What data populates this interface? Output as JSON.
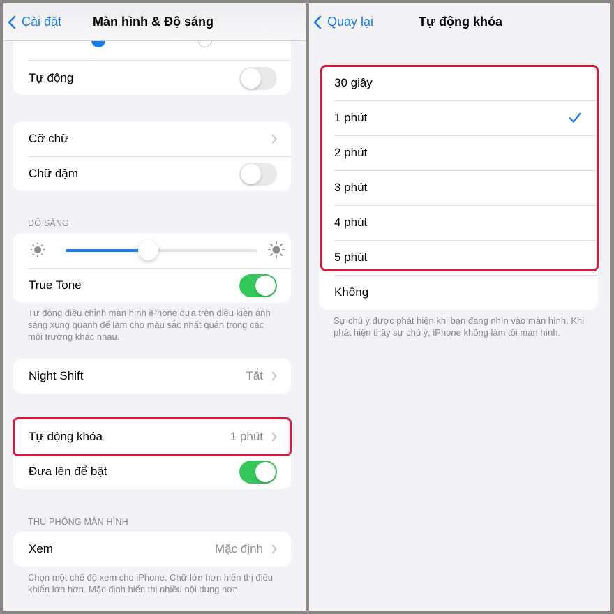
{
  "left": {
    "nav": {
      "back_label": "Cài đặt",
      "title": "Màn hình & Độ sáng"
    },
    "appearance": {
      "auto_label": "Tự động",
      "auto_on": false
    },
    "text": {
      "text_size_label": "Cỡ chữ",
      "bold_text_label": "Chữ đậm",
      "bold_text_on": false
    },
    "brightness": {
      "header": "ĐỘ SÁNG",
      "level_percent": 43,
      "true_tone_label": "True Tone",
      "true_tone_on": true,
      "footer": "Tự động điều chỉnh màn hình iPhone dựa trên điều kiện ánh sáng xung quanh để làm cho màu sắc nhất quán trong các môi trường khác nhau."
    },
    "night_shift": {
      "label": "Night Shift",
      "value": "Tắt"
    },
    "lock": {
      "auto_lock_label": "Tự động khóa",
      "auto_lock_value": "1 phút",
      "raise_to_wake_label": "Đưa lên để bật",
      "raise_to_wake_on": true
    },
    "zoom": {
      "header": "THU PHÓNG MÀN HÌNH",
      "view_label": "Xem",
      "view_value": "Mặc định",
      "footer": "Chọn một chế độ xem cho iPhone. Chữ lớn hơn hiển thị điều khiển lớn hơn. Mặc định hiển thị nhiều nội dung hơn."
    }
  },
  "right": {
    "nav": {
      "back_label": "Quay lại",
      "title": "Tự động khóa"
    },
    "options": [
      {
        "label": "30 giây",
        "selected": false
      },
      {
        "label": "1 phút",
        "selected": true
      },
      {
        "label": "2 phút",
        "selected": false
      },
      {
        "label": "3 phút",
        "selected": false
      },
      {
        "label": "4 phút",
        "selected": false
      },
      {
        "label": "5 phút",
        "selected": false
      },
      {
        "label": "Không",
        "selected": false
      }
    ],
    "footer": "Sự chú ý được phát hiện khi bạn đang nhìn vào màn hình. Khi phát hiện thấy sự chú ý, iPhone không làm tối màn hình."
  },
  "colors": {
    "accent": "#1b7cf0",
    "toggle_on": "#34c759",
    "highlight": "#d81a3a"
  }
}
